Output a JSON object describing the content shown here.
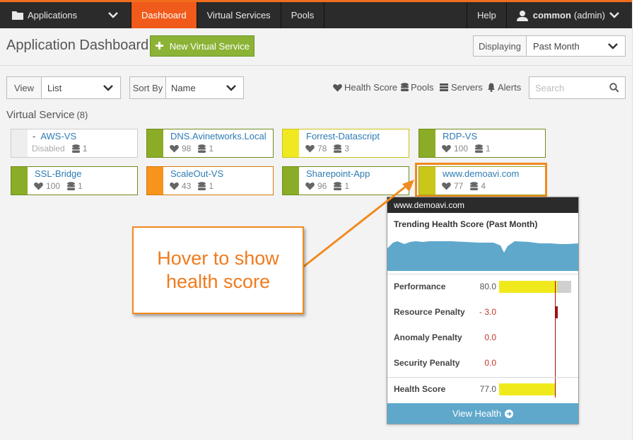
{
  "nav": {
    "apps_label": "Applications",
    "items": [
      {
        "label": "Dashboard",
        "active": true
      },
      {
        "label": "Virtual Services",
        "active": false
      },
      {
        "label": "Pools",
        "active": false
      }
    ],
    "help_label": "Help",
    "user_name": "common",
    "user_role": "(admin)"
  },
  "header": {
    "title": "Application Dashboard",
    "new_vs_label": "New Virtual Service",
    "displaying_label": "Displaying",
    "displaying_value": "Past Month"
  },
  "filters": {
    "view_label": "View",
    "view_value": "List",
    "sort_label": "Sort By",
    "sort_value": "Name",
    "legend": {
      "health_score": "Health Score",
      "pools": "Pools",
      "servers": "Servers",
      "alerts": "Alerts"
    },
    "search_placeholder": "Search"
  },
  "section": {
    "title": "Virtual Service",
    "count": "(8)"
  },
  "tiles": [
    {
      "name": "AWS-VS",
      "prefix": "-",
      "status_text": "Disabled",
      "health": "",
      "pools": "1",
      "color": "#eeeeee",
      "border": "#cccccc"
    },
    {
      "name": "DNS.Avinetworks.Local",
      "health": "98",
      "pools": "1",
      "color": "#8bac26",
      "border": "#6f8c1c"
    },
    {
      "name": "Forrest-Datascript",
      "health": "78",
      "pools": "3",
      "color": "#f0e922",
      "border": "#c9c21a"
    },
    {
      "name": "RDP-VS",
      "health": "100",
      "pools": "1",
      "color": "#8bac26",
      "border": "#6f8c1c"
    },
    {
      "name": "SSL-Bridge",
      "health": "100",
      "pools": "1",
      "color": "#8bac26",
      "border": "#6f8c1c"
    },
    {
      "name": "ScaleOut-VS",
      "health": "43",
      "pools": "1",
      "color": "#f7941d",
      "border": "#d6780a"
    },
    {
      "name": "Sharepoint-App",
      "health": "96",
      "pools": "1",
      "color": "#8bac26",
      "border": "#6f8c1c"
    },
    {
      "name": "www.demoavi.com",
      "health": "77",
      "pools": "4",
      "color": "#c9c81a",
      "border": "#a7a516"
    }
  ],
  "popup": {
    "title": "www.demoavi.com",
    "subtitle": "Trending Health Score (Past Month)",
    "rows": [
      {
        "label": "Performance",
        "value": "80.0"
      },
      {
        "label": "Resource Penalty",
        "value": "- 3.0"
      },
      {
        "label": "Anomaly Penalty",
        "value": "0.0"
      },
      {
        "label": "Security Penalty",
        "value": "0.0"
      }
    ],
    "health_label": "Health Score",
    "health_value": "77.0",
    "performance_fraction": 0.8,
    "health_fraction": 0.77,
    "view_health_label": "View Health",
    "trend_color": "#5fa8cc"
  },
  "callout": {
    "text": "Hover to show\nhealth score",
    "color": "#f07b1e"
  },
  "colors": {
    "accent": "#f05a1a",
    "nav_bg": "#2b2b2b",
    "link": "#2e7bb4",
    "new_button": "#8bb336"
  }
}
